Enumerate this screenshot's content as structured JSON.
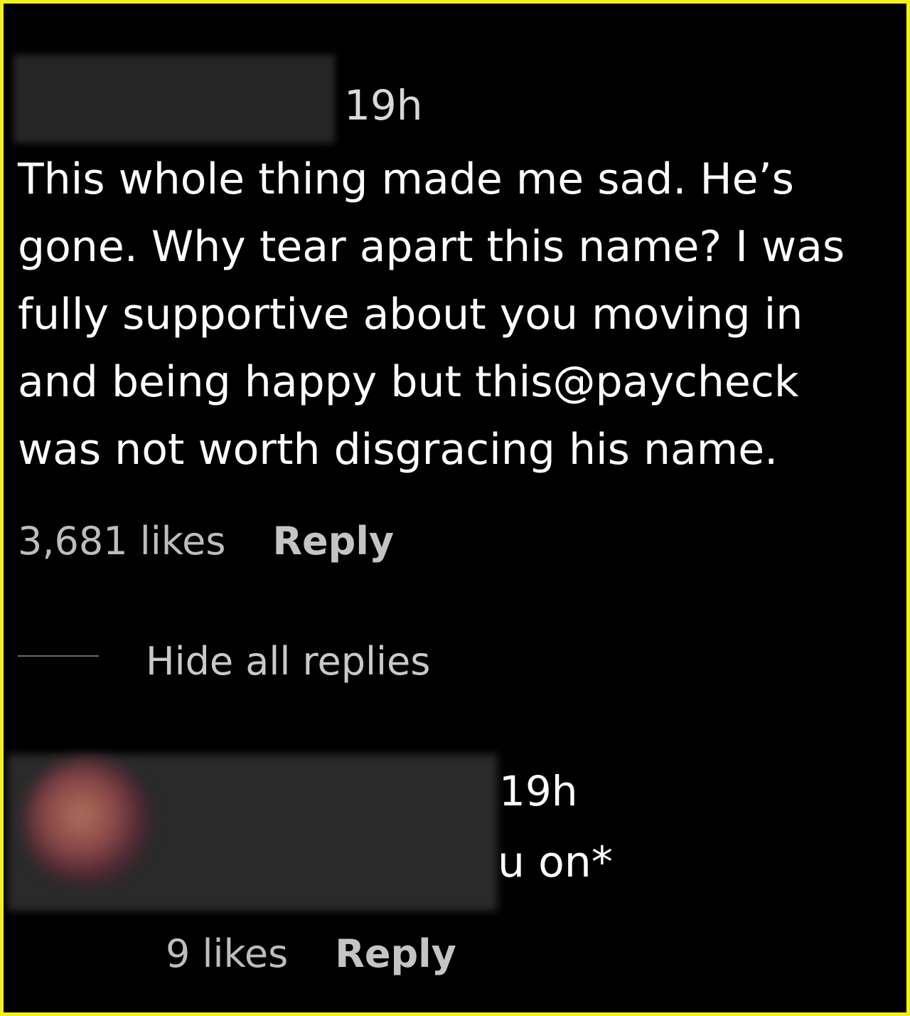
{
  "comment": {
    "timestamp": "19h",
    "text": "This whole thing made me sad. He’s\ngone. Why tear apart this name? I was\nfully supportive about you moving in\nand being happy but this@paycheck\nwas not worth disgracing his name.",
    "likes": "3,681 likes",
    "reply_label": "Reply"
  },
  "replies_toggle": {
    "label": "Hide all replies"
  },
  "reply": {
    "timestamp": "19h",
    "text": "u on*",
    "likes": "9 likes",
    "reply_label": "Reply"
  },
  "colors": {
    "frame_border": "#f3ef1a",
    "background": "#000000",
    "text_primary": "#ffffff",
    "text_secondary": "#bdbdbd"
  }
}
